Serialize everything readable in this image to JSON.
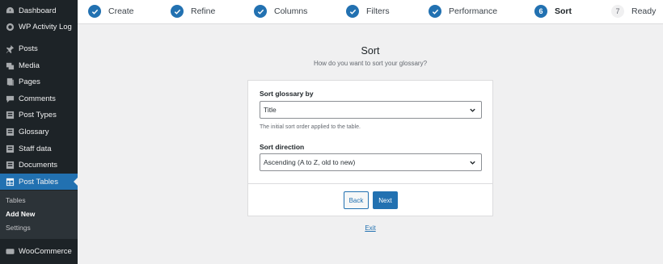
{
  "sidebar": {
    "items": [
      {
        "label": "Dashboard",
        "icon": "dashboard-icon"
      },
      {
        "label": "WP Activity Log",
        "icon": "activity-log-icon"
      },
      {
        "label": "Posts",
        "icon": "pin-icon"
      },
      {
        "label": "Media",
        "icon": "media-icon"
      },
      {
        "label": "Pages",
        "icon": "pages-icon"
      },
      {
        "label": "Comments",
        "icon": "comment-icon"
      },
      {
        "label": "Post Types",
        "icon": "post-types-icon"
      },
      {
        "label": "Glossary",
        "icon": "glossary-icon"
      },
      {
        "label": "Staff data",
        "icon": "staff-data-icon"
      },
      {
        "label": "Documents",
        "icon": "documents-icon"
      },
      {
        "label": "Post Tables",
        "icon": "table-icon"
      },
      {
        "label": "WooCommerce",
        "icon": "woocommerce-icon"
      }
    ],
    "submenu": [
      "Tables",
      "Add New",
      "Settings"
    ]
  },
  "steps": [
    {
      "label": "Create",
      "state": "done"
    },
    {
      "label": "Refine",
      "state": "done"
    },
    {
      "label": "Columns",
      "state": "done"
    },
    {
      "label": "Filters",
      "state": "done"
    },
    {
      "label": "Performance",
      "state": "done"
    },
    {
      "label": "Sort",
      "number": "6",
      "state": "current"
    },
    {
      "label": "Ready",
      "number": "7",
      "state": "future"
    }
  ],
  "main": {
    "title": "Sort",
    "subtitle": "How do you want to sort your glossary?",
    "sort_by": {
      "label": "Sort glossary by",
      "value": "Title",
      "help": "The initial sort order applied to the table."
    },
    "sort_direction": {
      "label": "Sort direction",
      "value": "Ascending (A to Z, old to new)"
    },
    "back_label": "Back",
    "next_label": "Next",
    "exit_label": "Exit"
  },
  "colors": {
    "accent": "#2271b1",
    "sidebar_bg": "#1d2327",
    "page_bg": "#f0f0f1"
  }
}
